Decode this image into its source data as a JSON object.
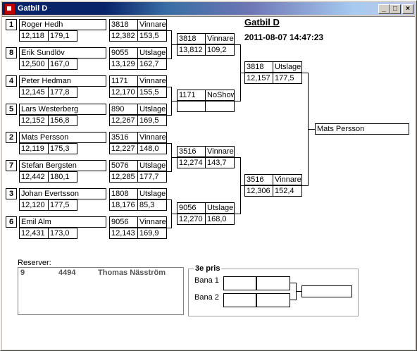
{
  "window": {
    "title": "Gatbil D",
    "min_label": "_",
    "max_label": "□",
    "close_label": "×"
  },
  "header": {
    "title": "Gatbil D",
    "datetime": "2011-08-07 14:47:23"
  },
  "seeds": [
    "1",
    "8",
    "4",
    "5",
    "2",
    "7",
    "3",
    "6"
  ],
  "round1": [
    {
      "name": "Roger Hedh",
      "time": "12,118",
      "speed": "179,1"
    },
    {
      "name": "Erik Sundlöv",
      "time": "12,500",
      "speed": "167,0"
    },
    {
      "name": "Peter Hedman",
      "time": "12,145",
      "speed": "177,8"
    },
    {
      "name": "Lars Westerberg",
      "time": "12,152",
      "speed": "156,8"
    },
    {
      "name": "Mats Persson",
      "time": "12,119",
      "speed": "175,3"
    },
    {
      "name": "Stefan Bergsten",
      "time": "12,442",
      "speed": "180,1"
    },
    {
      "name": "Johan Evertsson",
      "time": "12,120",
      "speed": "177,5"
    },
    {
      "name": "Emil Alm",
      "time": "12,431",
      "speed": "173,0"
    }
  ],
  "round2": [
    {
      "num": "3818",
      "result": "Vinnare",
      "time": "12,382",
      "speed": "153,5"
    },
    {
      "num": "9055",
      "result": "Utslagen",
      "time": "13,129",
      "speed": "162,7"
    },
    {
      "num": "1171",
      "result": "Vinnare",
      "time": "12,170",
      "speed": "155,5"
    },
    {
      "num": "890",
      "result": "Utslagen",
      "time": "12,267",
      "speed": "169,5"
    },
    {
      "num": "3516",
      "result": "Vinnare",
      "time": "12,227",
      "speed": "148,0"
    },
    {
      "num": "5076",
      "result": "Utslagen",
      "time": "12,285",
      "speed": "177,7"
    },
    {
      "num": "1808",
      "result": "Utslagen",
      "time": "18,176",
      "speed": "85,3"
    },
    {
      "num": "9056",
      "result": "Vinnare",
      "time": "12,143",
      "speed": "169,9"
    }
  ],
  "round3": [
    {
      "num": "3818",
      "result": "Vinnare",
      "time": "13,812",
      "speed": "109,2"
    },
    {
      "num": "1171",
      "result": "NoShow",
      "time": "",
      "speed": ""
    },
    {
      "num": "3516",
      "result": "Vinnare",
      "time": "12,274",
      "speed": "143,7"
    },
    {
      "num": "9056",
      "result": "Utslagen",
      "time": "12,270",
      "speed": "168,0"
    }
  ],
  "round4": [
    {
      "num": "3818",
      "result": "Utslagen",
      "time": "12,157",
      "speed": "177,5"
    },
    {
      "num": "3516",
      "result": "Vinnare",
      "time": "12,306",
      "speed": "152,4"
    }
  ],
  "final": {
    "winner": "Mats Persson"
  },
  "reserves": {
    "label": "Reserver:",
    "rows": [
      {
        "pos": "9",
        "num": "4494",
        "name": "Thomas Näsström"
      }
    ]
  },
  "third_prize": {
    "label": "3e pris",
    "lanes": [
      "Bana 1",
      "Bana 2"
    ]
  }
}
